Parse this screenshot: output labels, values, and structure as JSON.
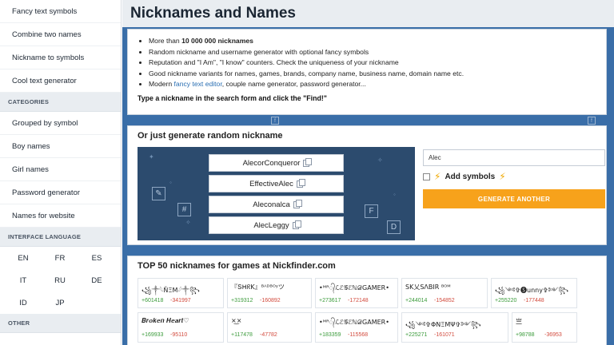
{
  "sidebar": {
    "top_items": [
      "Fancy text symbols",
      "Combine two names",
      "Nickname to symbols",
      "Cool text generator"
    ],
    "categories_label": "CATEGORIES",
    "categories": [
      "Grouped by symbol",
      "Boy names",
      "Girl names",
      "Password generator",
      "Names for website"
    ],
    "language_label": "INTERFACE LANGUAGE",
    "languages": [
      "EN",
      "FR",
      "ES",
      "IT",
      "RU",
      "DE",
      "ID",
      "JP"
    ],
    "other_label": "OTHER"
  },
  "header": {
    "title": "Nicknames and Names"
  },
  "intro": {
    "b1_pre": "More than ",
    "b1_bold": "10 000 000 nicknames",
    "b2": "Random nickname and username generator with optional fancy symbols",
    "b3": "Reputation and \"I Am\", \"I know\" counters. Check the uniqueness of your nickname",
    "b4": "Good nickname variants for names, games, brands, company name, business name, domain name etc.",
    "b5_pre": "Modern ",
    "b5_link": "fancy text editor",
    "b5_post": ", couple name generator, password generator...",
    "cta": "Type a nickname in the search form and click the \"Find!\""
  },
  "generator": {
    "title": "Or just generate random nickname",
    "nicknames": [
      "AlecorConqueror",
      "EffectiveAlec",
      "Aleconalca",
      "AlecLeggy"
    ],
    "input_value": "Alec",
    "symbols_label": "Add symbols",
    "button_label": "GENERATE ANOTHER"
  },
  "top50": {
    "title": "TOP 50 nicknames for games at Nickfinder.com",
    "cards": [
      {
        "name": "꧁⁣༒𓆩ŇΞΜ𓆪༒꧂",
        "up": "+601418",
        "down": "-341997"
      },
      {
        "name": "『ՏᕼᖇK』ᴮᴬᴰᴮᴼʸツ",
        "up": "+319312",
        "down": "-160892"
      },
      {
        "name": "•ᴹᴿ᭄ℒℰ𝒢ℰℕ𝒟GAMER•",
        "up": "+273617",
        "down": "-172148"
      },
      {
        "name": "SK乂SΛBIR ᴮᴼᴹ",
        "up": "+244014",
        "down": "-154852"
      },
      {
        "name": "꧁༺✞🅢unny✞༻꧂",
        "up": "+255220",
        "down": "-177448"
      },
      {
        "name": "𝑩𝒓𝒐𝒌𝒆𝒏 𝑯𝒆𝒂𝒓𝒕♡",
        "up": "+169933",
        "down": "-95110"
      },
      {
        "name": "×͜×",
        "up": "+117478",
        "down": "-47782"
      },
      {
        "name": "•ᴹᴿ᭄ℒℰ𝒢ℰℕ𝒟GAMER•",
        "up": "+183359",
        "down": "-115568"
      },
      {
        "name": "꧁༺✞ΦΝΞΜΨ✞༻꧂",
        "up": "+225271",
        "down": "-161071"
      },
      {
        "name": "亗",
        "up": "+98788",
        "down": "-36953"
      }
    ]
  },
  "colors": {
    "main_bg": "#3a6ea8",
    "accent_button": "#f7a21b",
    "up_votes": "#3b9b3b",
    "down_votes": "#d24a3d",
    "link": "#2a6fb3"
  }
}
